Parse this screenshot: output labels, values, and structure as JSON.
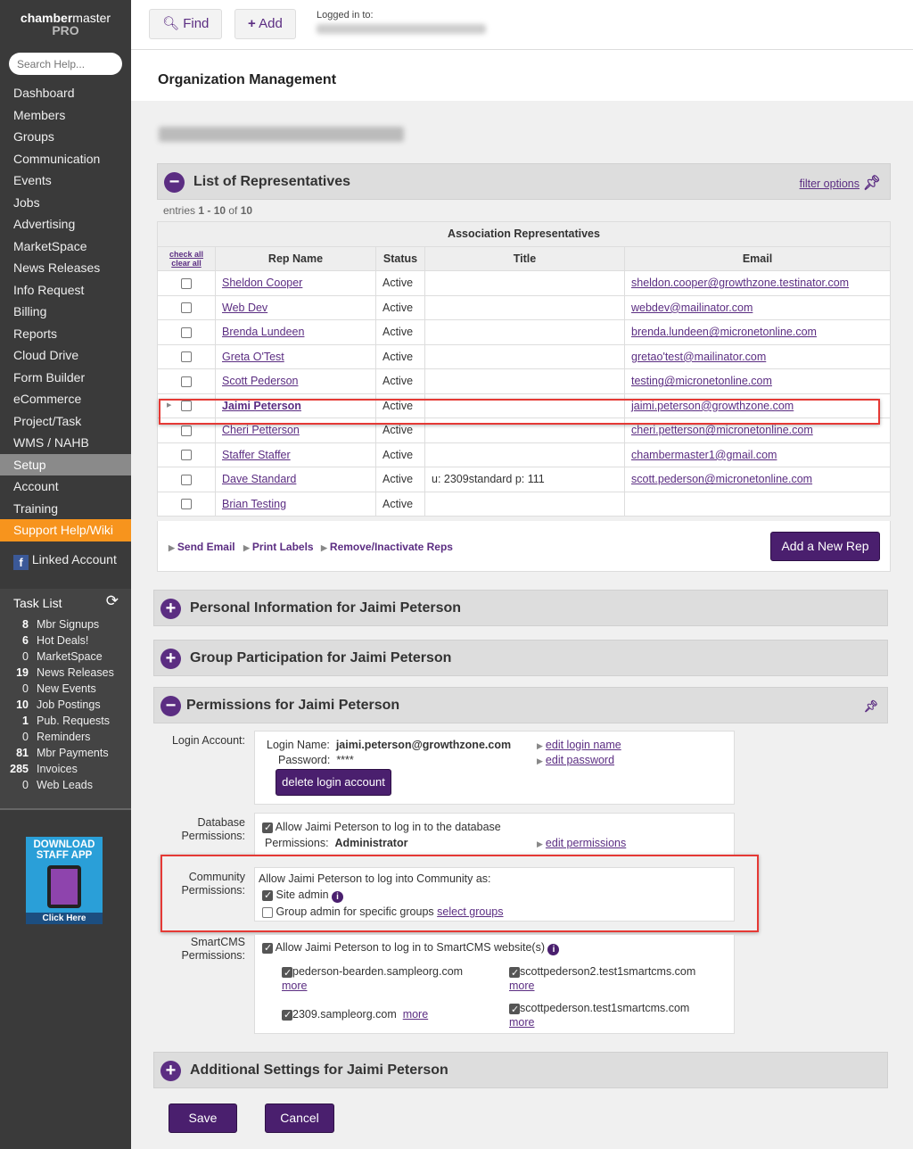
{
  "sidebar": {
    "logo_bold": "chamber",
    "logo_rest": "master",
    "logo_sub": "PRO",
    "search_placeholder": "Search Help...",
    "nav": [
      "Dashboard",
      "Members",
      "Groups",
      "Communication",
      "Events",
      "Jobs",
      "Advertising",
      "MarketSpace",
      "News Releases",
      "Info Request",
      "Billing",
      "Reports",
      "Cloud Drive",
      "Form Builder",
      "eCommerce",
      "Project/Task",
      "WMS / NAHB",
      "Setup",
      "Account",
      "Training",
      "Support Help/Wiki"
    ],
    "linked": "Linked Account",
    "task_title": "Task List",
    "tasks": [
      {
        "n": "8",
        "l": "Mbr Signups",
        "b": true
      },
      {
        "n": "6",
        "l": "Hot Deals!",
        "b": true
      },
      {
        "n": "0",
        "l": "MarketSpace",
        "b": false
      },
      {
        "n": "19",
        "l": "News Releases",
        "b": true
      },
      {
        "n": "0",
        "l": "New Events",
        "b": false
      },
      {
        "n": "10",
        "l": "Job Postings",
        "b": true
      },
      {
        "n": "1",
        "l": "Pub. Requests",
        "b": true
      },
      {
        "n": "0",
        "l": "Reminders",
        "b": false
      },
      {
        "n": "81",
        "l": "Mbr Payments",
        "b": true
      },
      {
        "n": "285",
        "l": "Invoices",
        "b": true
      },
      {
        "n": "0",
        "l": "Web Leads",
        "b": false
      }
    ],
    "app_line1": "DOWNLOAD",
    "app_line2": "STAFF APP",
    "app_click": "Click Here"
  },
  "header": {
    "find": "Find",
    "add": "Add",
    "logged_in": "Logged in to:"
  },
  "page_title": "Organization Management",
  "reps": {
    "title": "List of Representatives",
    "filter": "filter options",
    "entries_pre": "entries ",
    "entries_range": "1 - 10",
    "entries_of": " of ",
    "entries_total": "10",
    "table_caption": "Association Representatives",
    "check_all": "check all",
    "clear_all": "clear all",
    "columns": [
      "Rep Name",
      "Status",
      "Title",
      "Email"
    ],
    "rows": [
      {
        "name": "Sheldon Cooper",
        "status": "Active",
        "title": "",
        "email": "sheldon.cooper@growthzone.testinator.com"
      },
      {
        "name": "Web Dev",
        "status": "Active",
        "title": "",
        "email": "webdev@mailinator.com"
      },
      {
        "name": "Brenda Lundeen",
        "status": "Active",
        "title": "",
        "email": "brenda.lundeen@micronetonline.com"
      },
      {
        "name": "Greta O'Test",
        "status": "Active",
        "title": "",
        "email": "gretao'test@mailinator.com"
      },
      {
        "name": "Scott Pederson",
        "status": "Active",
        "title": "",
        "email": "testing@micronetonline.com"
      },
      {
        "name": "Jaimi Peterson",
        "status": "Active",
        "title": "",
        "email": "jaimi.peterson@growthzone.com",
        "selected": true
      },
      {
        "name": "Cheri Petterson",
        "status": "Active",
        "title": "",
        "email": "cheri.petterson@micronetonline.com"
      },
      {
        "name": "Staffer Staffer",
        "status": "Active",
        "title": "",
        "email": "chambermaster1@gmail.com"
      },
      {
        "name": "Dave Standard",
        "status": "Active",
        "title": "u: 2309standard p: 111",
        "email": "scott.pederson@micronetonline.com"
      },
      {
        "name": "Brian Testing",
        "status": "Active",
        "title": "",
        "email": ""
      }
    ],
    "send_email": "Send Email",
    "print_labels": "Print Labels",
    "remove": "Remove/Inactivate Reps",
    "add_rep": "Add a New Rep"
  },
  "sections": {
    "personal": "Personal Information for Jaimi Peterson",
    "group": "Group Participation for Jaimi Peterson",
    "permissions": "Permissions for Jaimi Peterson",
    "additional": "Additional Settings for Jaimi Peterson"
  },
  "perm": {
    "login_label": "Login Account:",
    "login_name_label": "Login Name:",
    "login_name": "jaimi.peterson@growthzone.com",
    "password_label": "Password:",
    "password": "****",
    "edit_login": "edit login name",
    "edit_password": "edit password",
    "delete_login": "delete login account",
    "db_label1": "Database",
    "db_label2": "Permissions:",
    "db_allow": "Allow Jaimi Peterson to log in to the database",
    "db_perm_label": "Permissions:",
    "db_perm": "Administrator",
    "edit_perm": "edit permissions",
    "comm_label1": "Community",
    "comm_label2": "Permissions:",
    "comm_allow": "Allow Jaimi Peterson to log into Community as:",
    "site_admin": "Site admin",
    "group_admin": "Group admin for specific groups",
    "select_groups": "select groups",
    "cms_label1": "SmartCMS",
    "cms_label2": "Permissions:",
    "cms_allow": "Allow Jaimi Peterson to log in to SmartCMS website(s)",
    "sites": [
      "pederson-bearden.sampleorg.com",
      "scottpederson2.test1smartcms.com",
      "2309.sampleorg.com",
      "scottpederson.test1smartcms.com"
    ],
    "more": "more"
  },
  "footer": {
    "save": "Save",
    "cancel": "Cancel"
  }
}
